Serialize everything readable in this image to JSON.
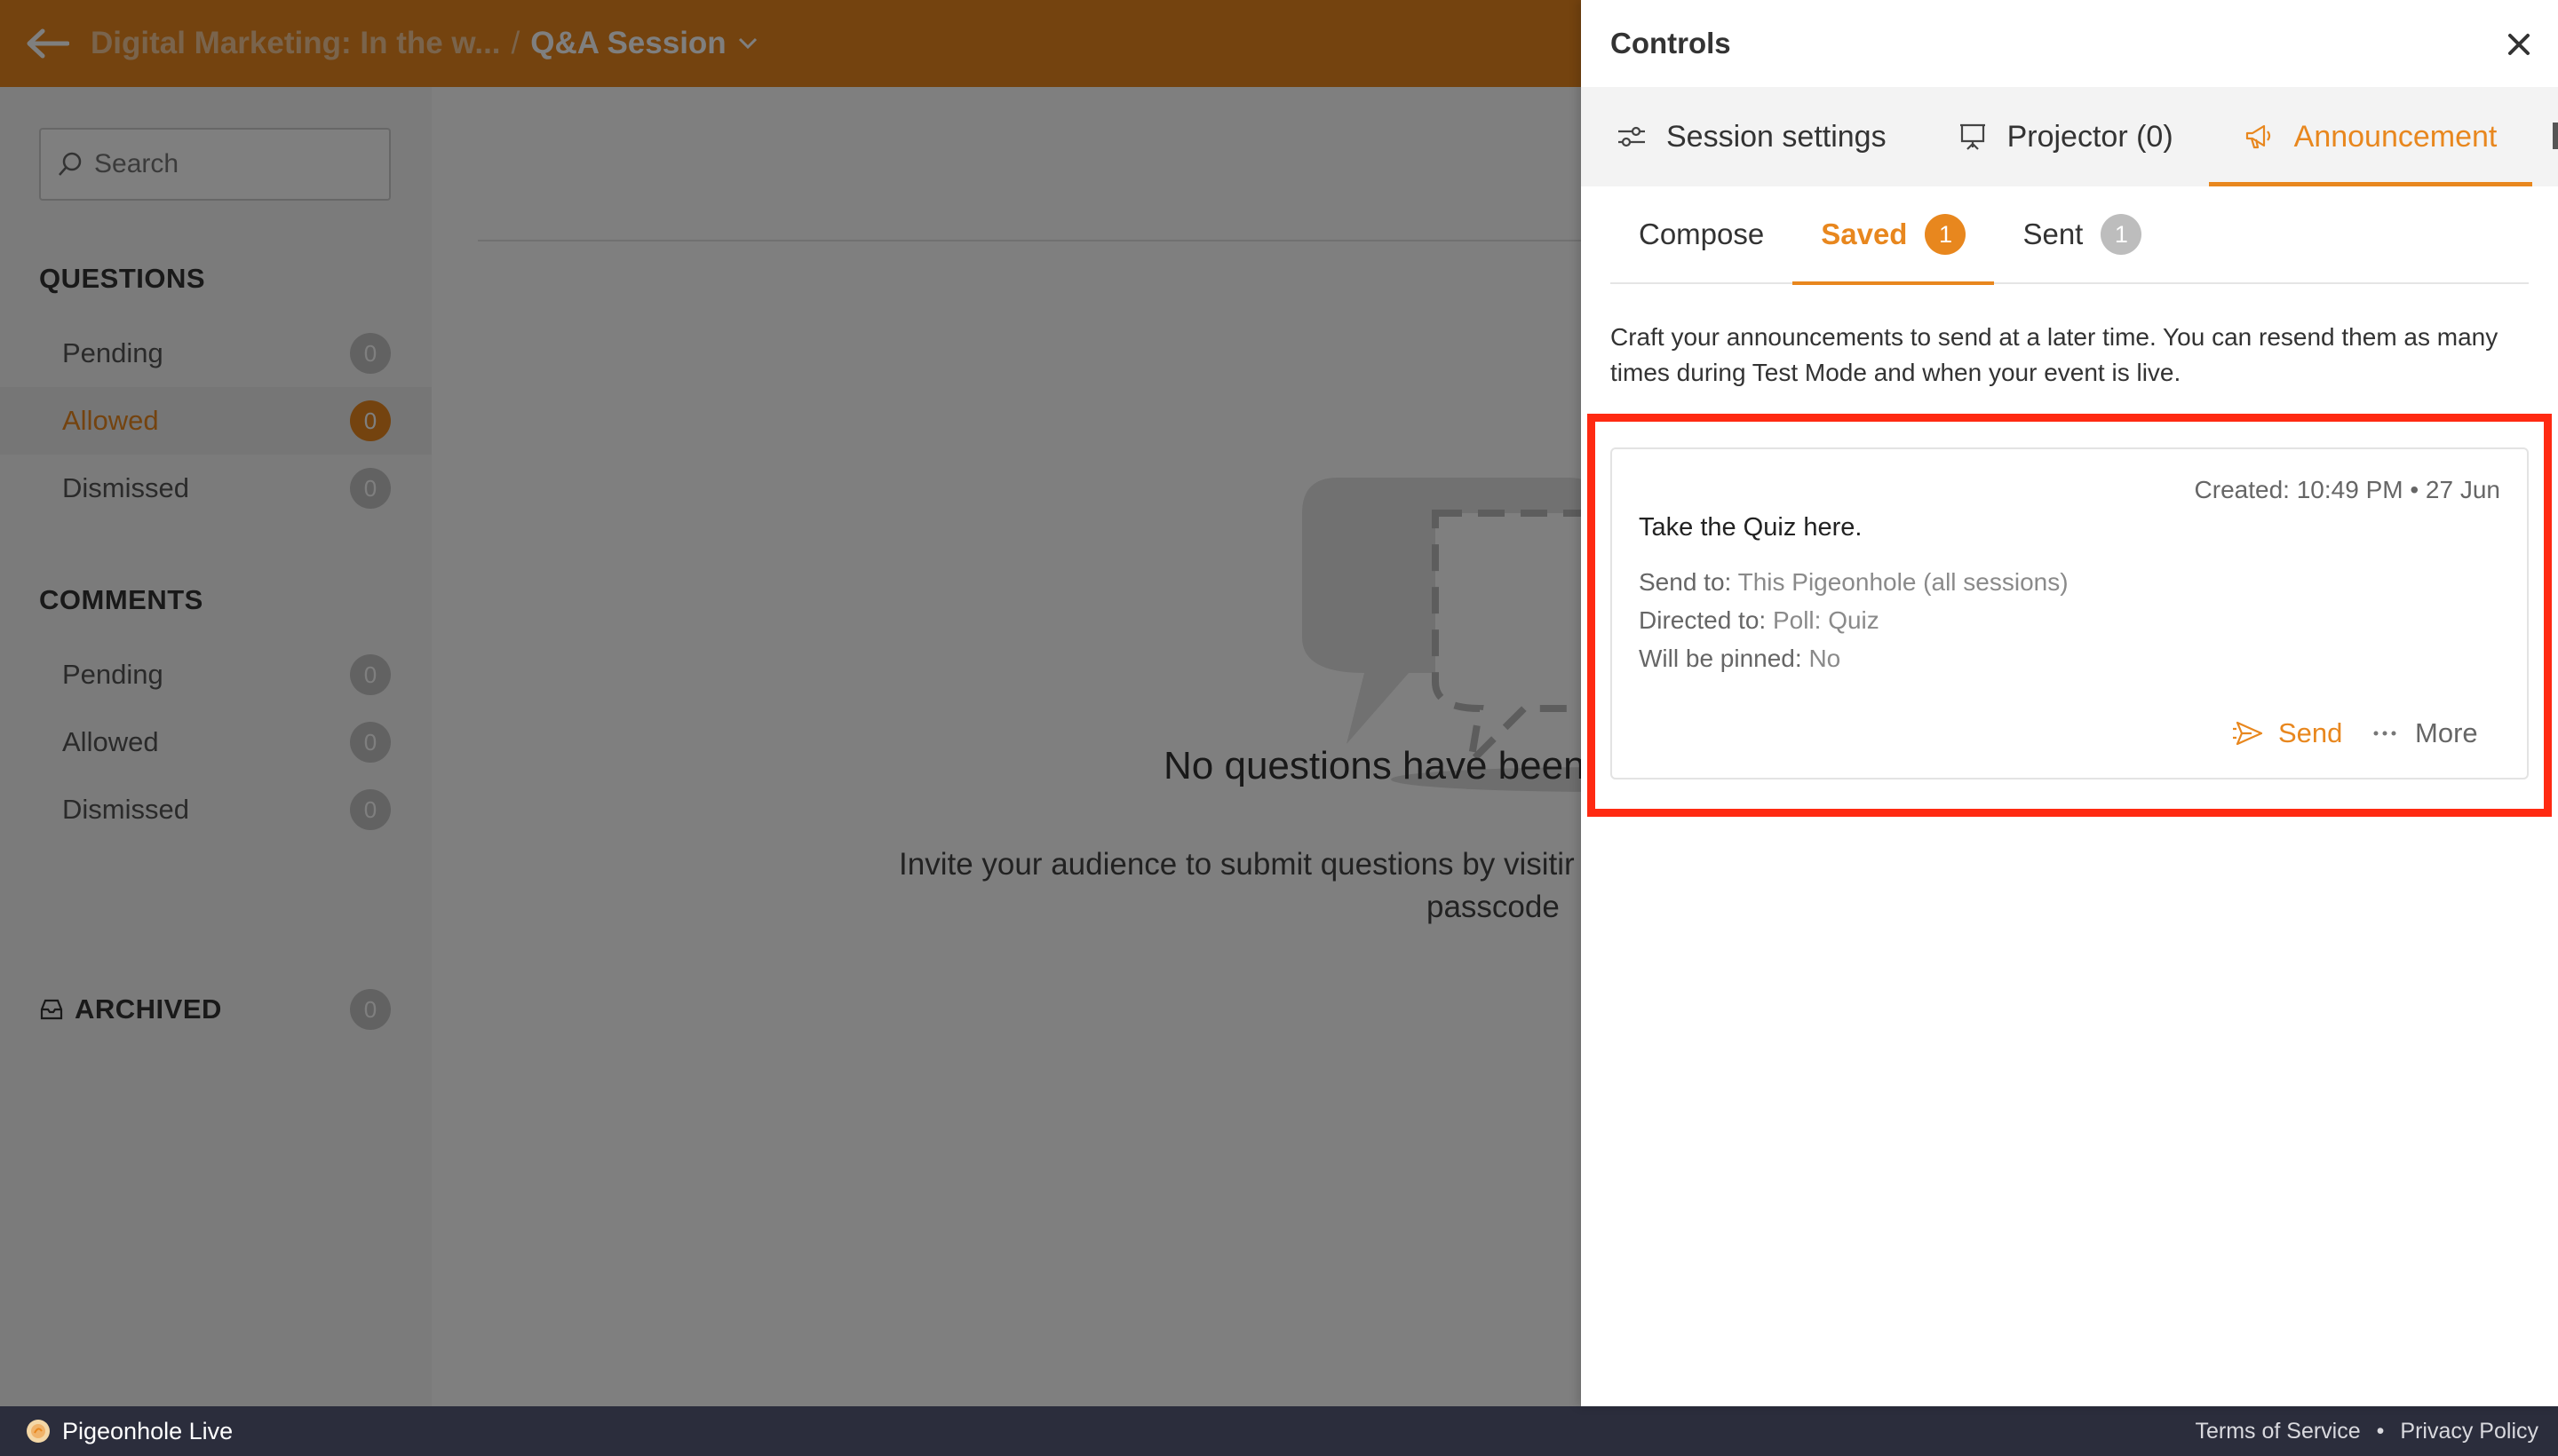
{
  "topbar": {
    "event_title": "Digital Marketing: In the w...",
    "separator": "/",
    "session_title": "Q&A Session"
  },
  "sidebar": {
    "search_placeholder": "Search",
    "questions": {
      "title": "QUESTIONS",
      "items": [
        {
          "label": "Pending",
          "count": "0"
        },
        {
          "label": "Allowed",
          "count": "0"
        },
        {
          "label": "Dismissed",
          "count": "0"
        }
      ]
    },
    "comments": {
      "title": "COMMENTS",
      "items": [
        {
          "label": "Pending",
          "count": "0"
        },
        {
          "label": "Allowed",
          "count": "0"
        },
        {
          "label": "Dismissed",
          "count": "0"
        }
      ]
    },
    "archived": {
      "label": "ARCHIVED",
      "count": "0"
    }
  },
  "main": {
    "empty_title": "No questions have been",
    "empty_desc_line1": "Invite your audience to submit questions by visitir",
    "empty_desc_line2": "passcode"
  },
  "footer": {
    "brand": "Pigeonhole Live",
    "terms": "Terms of Service",
    "dot": "•",
    "privacy": "Privacy Policy"
  },
  "panel": {
    "title": "Controls",
    "tabs": [
      {
        "label": "Session settings",
        "icon": "sliders-icon"
      },
      {
        "label": "Projector (0)",
        "icon": "projector-icon"
      },
      {
        "label": "Announcement",
        "icon": "megaphone-icon"
      }
    ],
    "sub_tabs": {
      "compose": "Compose",
      "saved": "Saved",
      "saved_count": "1",
      "sent": "Sent",
      "sent_count": "1"
    },
    "description": "Craft your announcements to send at a later time. You can resend them as many times during Test Mode and when your event is live.",
    "announcement": {
      "created": "Created: 10:49 PM • 27 Jun",
      "title": "Take the Quiz here.",
      "send_to_label": "Send to:",
      "send_to_value": "This Pigeonhole (all sessions)",
      "directed_to_label": "Directed to:",
      "directed_to_value": "Poll: Quiz",
      "pinned_label": "Will be pinned:",
      "pinned_value": "No",
      "send_label": "Send",
      "more_label": "More"
    }
  },
  "colors": {
    "brand_orange": "#e8871e",
    "highlight_red": "#ff2a12",
    "footer_bg": "#2b2d3c"
  }
}
